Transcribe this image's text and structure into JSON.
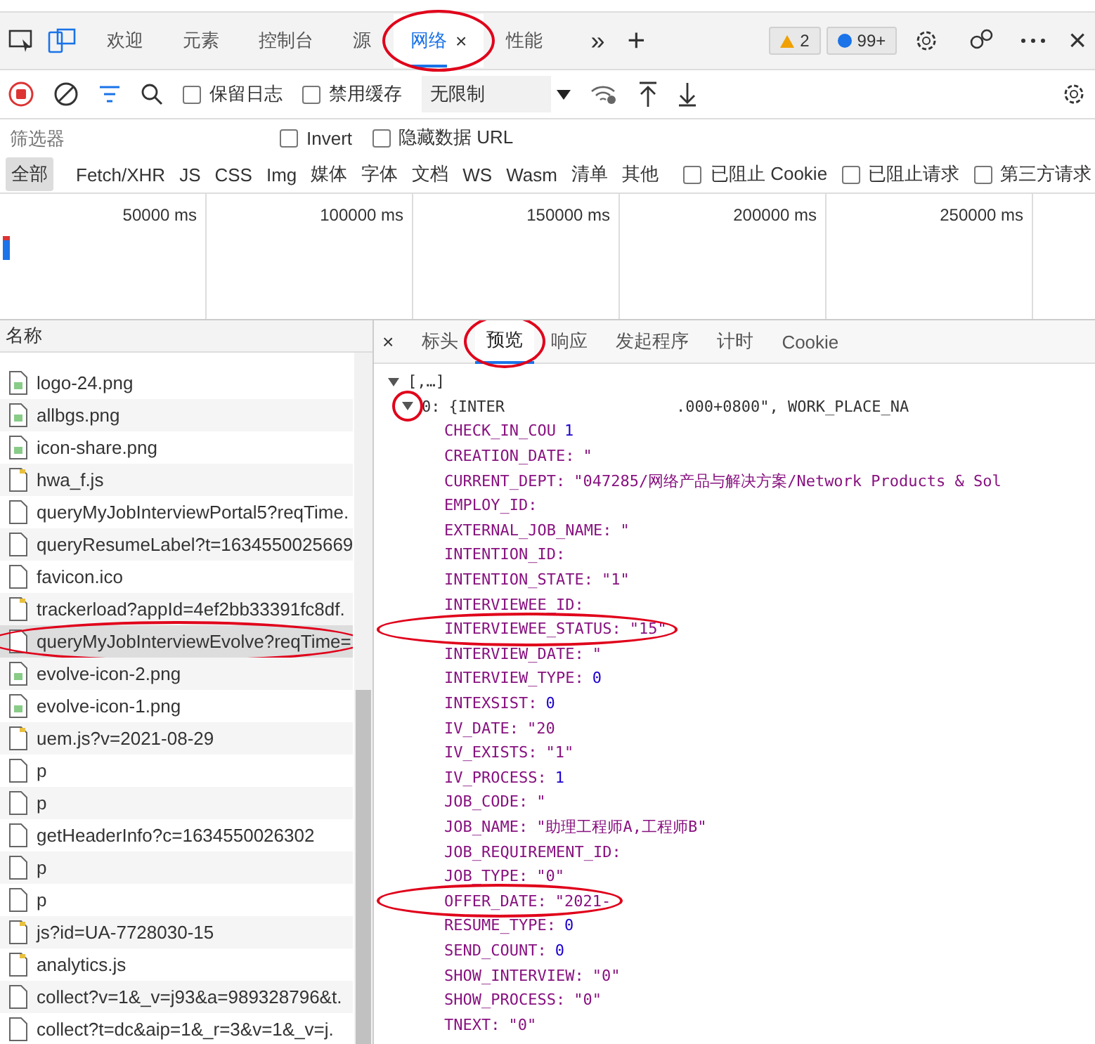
{
  "tabs": [
    {
      "label": "欢迎",
      "selected": false,
      "circled": false
    },
    {
      "label": "元素",
      "selected": false,
      "circled": false
    },
    {
      "label": "控制台",
      "selected": false,
      "circled": false
    },
    {
      "label": "源",
      "selected": false,
      "circled": false
    },
    {
      "label": "网络",
      "selected": true,
      "circled": true,
      "close": "×"
    },
    {
      "label": "性能",
      "selected": false,
      "circled": false
    }
  ],
  "more": "»",
  "add": "+",
  "badges": [
    {
      "kind": "warning",
      "count": "2"
    },
    {
      "kind": "message",
      "count": "99+"
    }
  ],
  "close": "×",
  "toolbar": {
    "checkboxes": [
      {
        "label": "保留日志",
        "checked": false
      },
      {
        "label": "禁用缓存",
        "checked": false
      }
    ],
    "throttle": "无限制"
  },
  "filter": {
    "placeholder": "筛选器",
    "checkboxes": [
      {
        "label": "Invert",
        "checked": false
      },
      {
        "label": "隐藏数据 URL",
        "checked": false
      }
    ]
  },
  "types": [
    {
      "label": "全部",
      "selected": true
    },
    {
      "label": "Fetch/XHR",
      "selected": false
    },
    {
      "label": "JS",
      "selected": false
    },
    {
      "label": "CSS",
      "selected": false
    },
    {
      "label": "Img",
      "selected": false
    },
    {
      "label": "媒体",
      "selected": false
    },
    {
      "label": "字体",
      "selected": false
    },
    {
      "label": "文档",
      "selected": false
    },
    {
      "label": "WS",
      "selected": false
    },
    {
      "label": "Wasm",
      "selected": false
    },
    {
      "label": "清单",
      "selected": false
    },
    {
      "label": "其他",
      "selected": false
    }
  ],
  "type_checkboxes": [
    {
      "label": "已阻止 Cookie",
      "checked": false
    },
    {
      "label": "已阻止请求",
      "checked": false
    },
    {
      "label": "第三方请求",
      "checked": false
    }
  ],
  "timeline": [
    "50000 ms",
    "100000 ms",
    "150000 ms",
    "200000 ms",
    "250000 ms"
  ],
  "requests": {
    "header": "名称",
    "rows": [
      {
        "name": "logo-24.png",
        "kind": "image",
        "selected": false,
        "circled": false
      },
      {
        "name": "allbgs.png",
        "kind": "image",
        "selected": false,
        "circled": false
      },
      {
        "name": "icon-share.png",
        "kind": "image",
        "selected": false,
        "circled": false
      },
      {
        "name": "hwa_f.js",
        "kind": "script",
        "selected": false,
        "circled": false
      },
      {
        "name": "queryMyJobInterviewPortal5?reqTime.",
        "kind": "document",
        "selected": false,
        "circled": false
      },
      {
        "name": "queryResumeLabel?t=1634550025669",
        "kind": "document",
        "selected": false,
        "circled": false
      },
      {
        "name": "favicon.ico",
        "kind": "document",
        "selected": false,
        "circled": false
      },
      {
        "name": "trackerload?appId=4ef2bb33391fc8df.",
        "kind": "script",
        "selected": false,
        "circled": false
      },
      {
        "name": "queryMyJobInterviewEvolve?reqTime=",
        "kind": "document",
        "selected": true,
        "circled": true
      },
      {
        "name": "evolve-icon-2.png",
        "kind": "image",
        "selected": false,
        "circled": false
      },
      {
        "name": "evolve-icon-1.png",
        "kind": "image",
        "selected": false,
        "circled": false
      },
      {
        "name": "uem.js?v=2021-08-29",
        "kind": "script",
        "selected": false,
        "circled": false
      },
      {
        "name": "p",
        "kind": "document",
        "selected": false,
        "circled": false
      },
      {
        "name": "p",
        "kind": "document",
        "selected": false,
        "circled": false
      },
      {
        "name": "getHeaderInfo?c=1634550026302",
        "kind": "document",
        "selected": false,
        "circled": false
      },
      {
        "name": "p",
        "kind": "document",
        "selected": false,
        "circled": false
      },
      {
        "name": "p",
        "kind": "document",
        "selected": false,
        "circled": false
      },
      {
        "name": "js?id=UA-7728030-15",
        "kind": "script",
        "selected": false,
        "circled": false
      },
      {
        "name": "analytics.js",
        "kind": "script",
        "selected": false,
        "circled": false
      },
      {
        "name": "collect?v=1&_v=j93&a=989328796&t.",
        "kind": "document",
        "selected": false,
        "circled": false
      },
      {
        "name": "collect?t=dc&aip=1&_r=3&v=1&_v=j.",
        "kind": "document",
        "selected": false,
        "circled": false
      }
    ]
  },
  "detail": {
    "close": "×",
    "tabs": [
      {
        "label": "标头",
        "selected": false,
        "circled": false
      },
      {
        "label": "预览",
        "selected": true,
        "circled": true
      },
      {
        "label": "响应",
        "selected": false,
        "circled": false
      },
      {
        "label": "发起程序",
        "selected": false,
        "circled": false
      },
      {
        "label": "计时",
        "selected": false,
        "circled": false
      },
      {
        "label": "Cookie",
        "selected": false,
        "circled": false
      }
    ],
    "root": {
      "label": "[,…]",
      "expanded": true
    },
    "item": {
      "index": "0:",
      "summary": "{INTER",
      "summary_tail": ".000+0800\", WORK_PLACE_NA",
      "expanded": true,
      "circled": true
    },
    "fields": [
      {
        "key": "CHECK_IN_COU",
        "value": "1",
        "kind": "number",
        "circled": false
      },
      {
        "key": "CREATION_DATE:",
        "value": "\"",
        "kind": "string",
        "circled": false
      },
      {
        "key": "CURRENT_DEPT:",
        "value": "\"047285/网络产品与解决方案/Network Products & Sol",
        "kind": "string",
        "circled": false
      },
      {
        "key": "EMPLOY_ID:",
        "circled": false
      },
      {
        "key": "EXTERNAL_JOB_NAME:",
        "value": "\"",
        "kind": "string",
        "circled": false
      },
      {
        "key": "INTENTION_ID:",
        "circled": false
      },
      {
        "key": "INTENTION_STATE:",
        "value": "\"1\"",
        "kind": "string",
        "circled": false
      },
      {
        "key": "INTERVIEWEE_ID:",
        "circled": false
      },
      {
        "key": "INTERVIEWEE_STATUS:",
        "value": "\"15\"",
        "kind": "string",
        "circled": true
      },
      {
        "key": "INTERVIEW_DATE:",
        "value": "\"",
        "kind": "string",
        "circled": false
      },
      {
        "key": "INTERVIEW_TYPE:",
        "value": "0",
        "kind": "number",
        "circled": false
      },
      {
        "key": "INTEXSIST:",
        "value": "0",
        "kind": "number",
        "circled": false
      },
      {
        "key": "IV_DATE:",
        "value": "\"20",
        "kind": "string",
        "circled": false
      },
      {
        "key": "IV_EXISTS:",
        "value": "\"1\"",
        "kind": "string",
        "circled": false
      },
      {
        "key": "IV_PROCESS:",
        "value": "1",
        "kind": "number",
        "circled": false
      },
      {
        "key": "JOB_CODE:",
        "value": "\"",
        "kind": "string",
        "circled": false
      },
      {
        "key": "JOB_NAME:",
        "value": "\"助理工程师A,工程师B\"",
        "kind": "string",
        "circled": false
      },
      {
        "key": "JOB_REQUIREMENT_ID:",
        "circled": false
      },
      {
        "key": "JOB_TYPE:",
        "value": "\"0\"",
        "kind": "string",
        "circled": false
      },
      {
        "key": "OFFER_DATE:",
        "value": "\"2021-",
        "kind": "string",
        "circled": true
      },
      {
        "key": "RESUME_TYPE:",
        "value": "0",
        "kind": "number",
        "circled": false
      },
      {
        "key": "SEND_COUNT:",
        "value": "0",
        "kind": "number",
        "circled": false
      },
      {
        "key": "SHOW_INTERVIEW:",
        "value": "\"0\"",
        "kind": "string",
        "circled": false
      },
      {
        "key": "SHOW_PROCESS:",
        "value": "\"0\"",
        "kind": "string",
        "circled": false
      },
      {
        "key": "TNEXT:",
        "value": "\"0\"",
        "kind": "string",
        "circled": false
      }
    ]
  }
}
